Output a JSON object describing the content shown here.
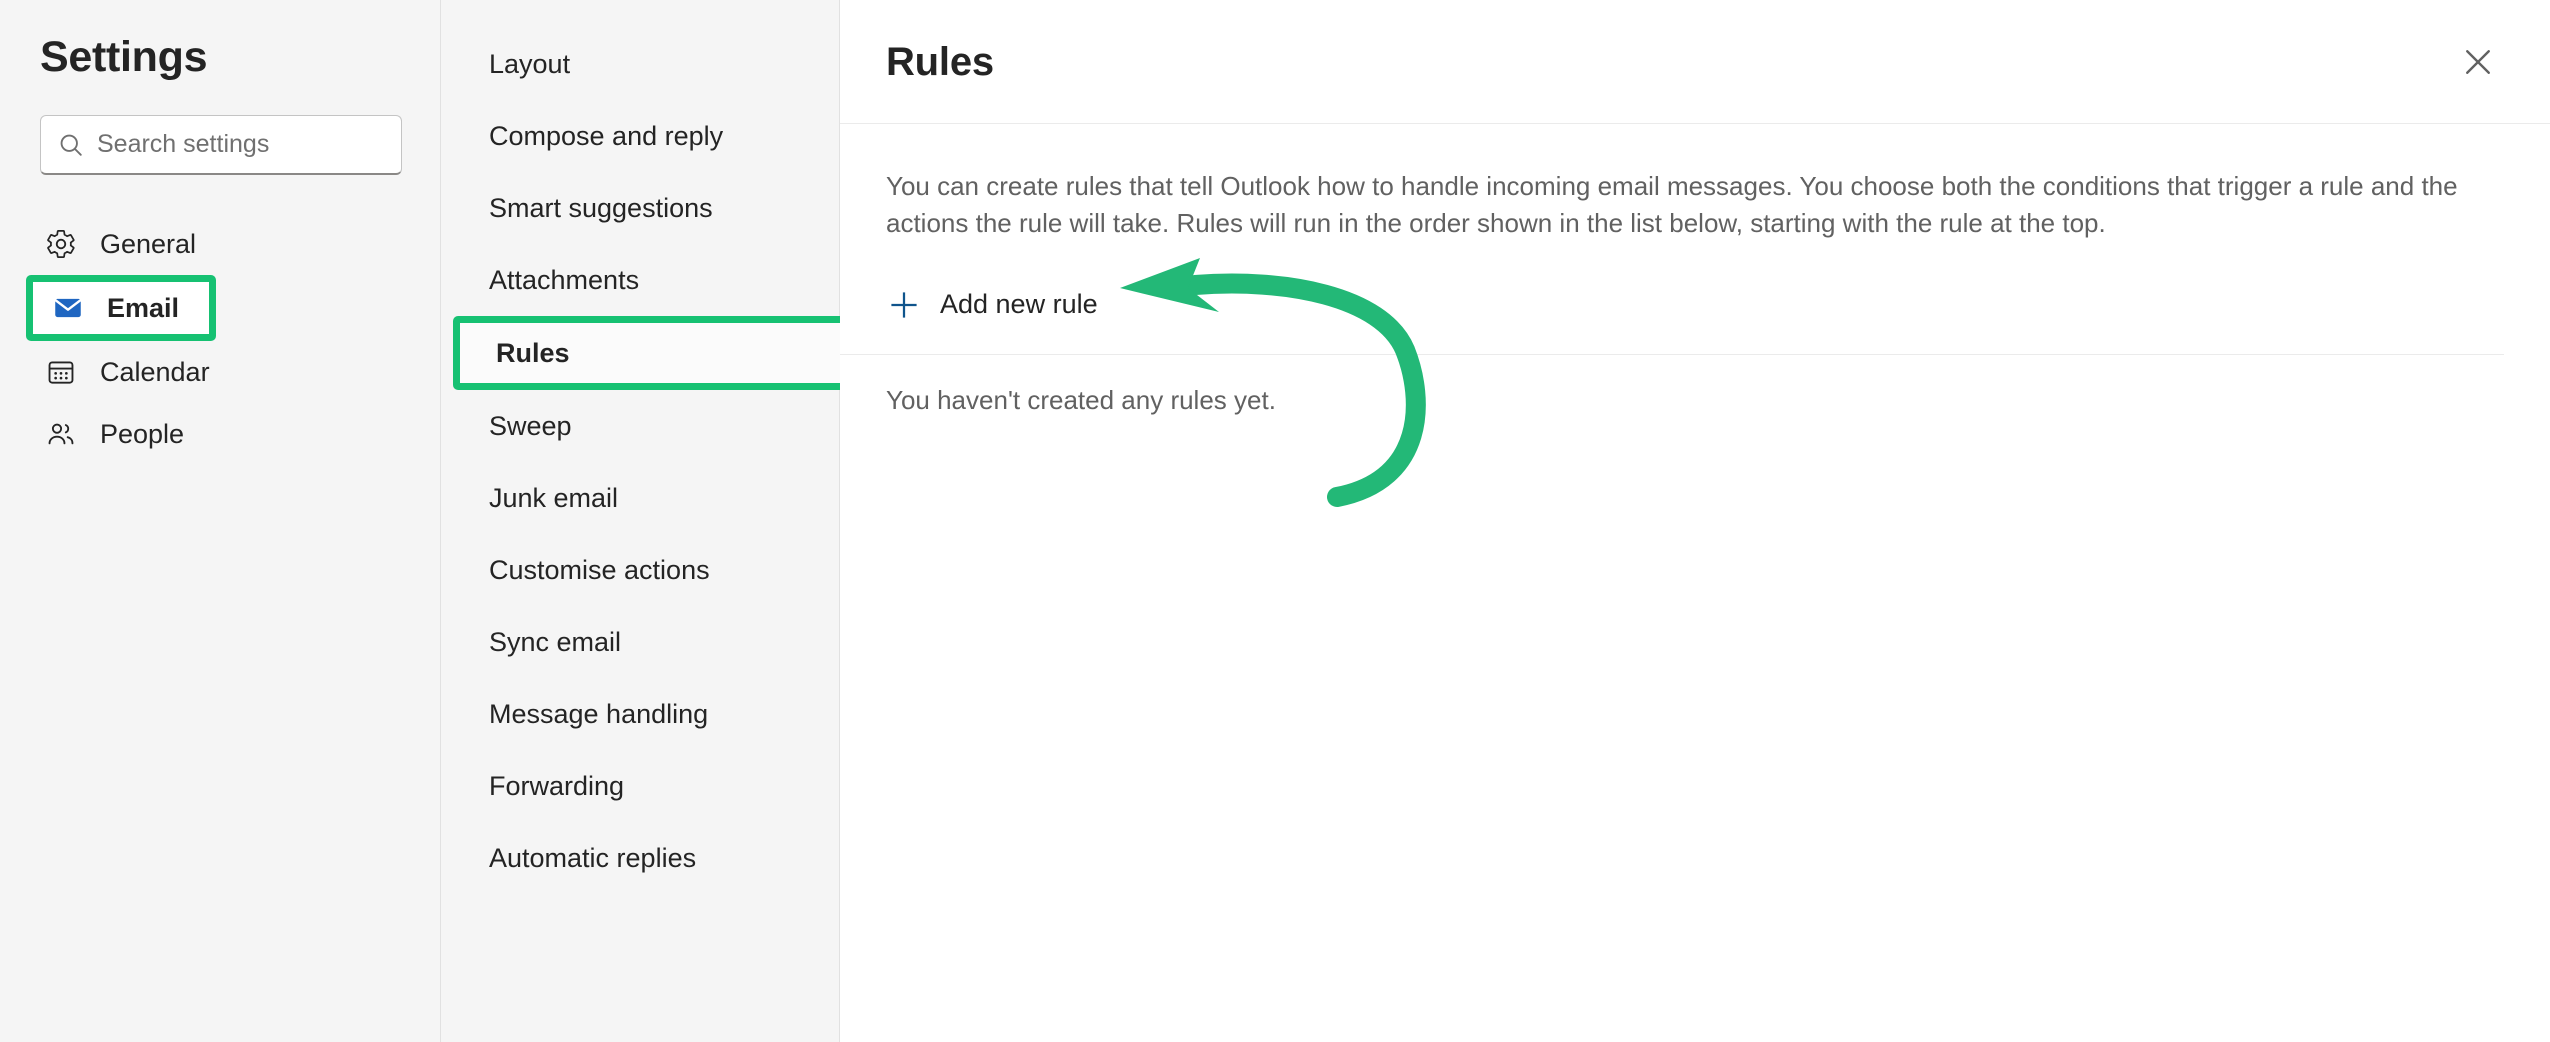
{
  "sidebar": {
    "title": "Settings",
    "search": {
      "placeholder": "Search settings",
      "value": "",
      "icon": "search-icon"
    },
    "items": [
      {
        "label": "General",
        "icon": "gear-icon",
        "selected": false,
        "annotated": false
      },
      {
        "label": "Email",
        "icon": "envelope-icon",
        "selected": true,
        "annotated": true
      },
      {
        "label": "Calendar",
        "icon": "calendar-icon",
        "selected": false,
        "annotated": false
      },
      {
        "label": "People",
        "icon": "people-icon",
        "selected": false,
        "annotated": false
      }
    ]
  },
  "midcolumn": {
    "items": [
      {
        "label": "Layout",
        "annotated": false
      },
      {
        "label": "Compose and reply",
        "annotated": false
      },
      {
        "label": "Smart suggestions",
        "annotated": false
      },
      {
        "label": "Attachments",
        "annotated": false
      },
      {
        "label": "Rules",
        "annotated": true
      },
      {
        "label": "Sweep",
        "annotated": false
      },
      {
        "label": "Junk email",
        "annotated": false
      },
      {
        "label": "Customise actions",
        "annotated": false
      },
      {
        "label": "Sync email",
        "annotated": false
      },
      {
        "label": "Message handling",
        "annotated": false
      },
      {
        "label": "Forwarding",
        "annotated": false
      },
      {
        "label": "Automatic replies",
        "annotated": false
      }
    ]
  },
  "main": {
    "title": "Rules",
    "close_label": "Close",
    "close_icon": "close-icon",
    "description": "You can create rules that tell Outlook how to handle incoming email messages. You choose both the conditions that trigger a rule and the actions the rule will take. Rules will run in the order shown in the list below, starting with the rule at the top.",
    "add_rule": {
      "label": "Add new rule",
      "icon": "plus-icon"
    },
    "empty_state": "You haven't created any rules yet."
  },
  "annotation": {
    "highlight_color": "#16c172",
    "arrow_color": "#23b877",
    "arrow_target": "add-new-rule-button",
    "accent_color": "#0f6cbd"
  }
}
